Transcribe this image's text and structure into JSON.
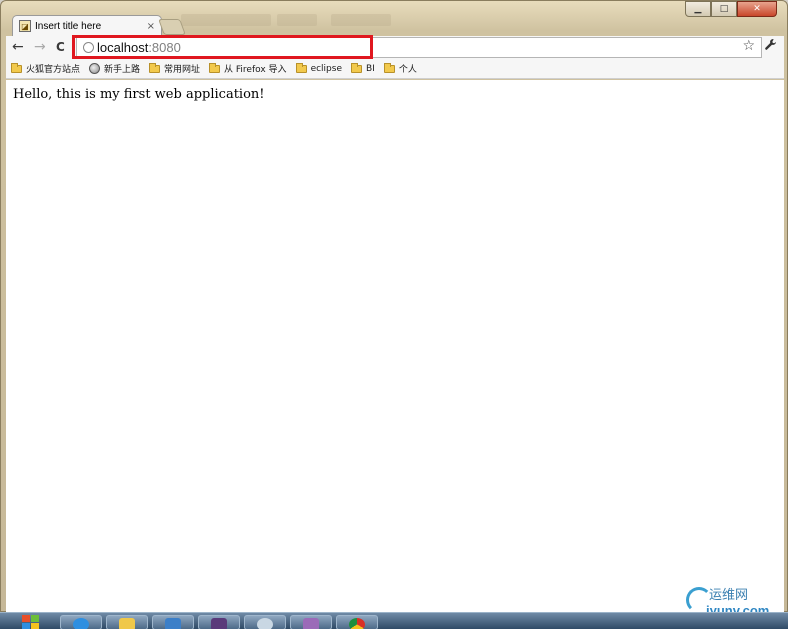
{
  "tab": {
    "title": "Insert title here",
    "close": "×"
  },
  "window_controls": {
    "minimize": "▁",
    "maximize": "□",
    "close": "✕"
  },
  "toolbar": {
    "back": "←",
    "forward": "→",
    "reload": "C",
    "url_host": "localhost",
    "url_port": ":8080",
    "star": "☆",
    "wrench": "🔧"
  },
  "bookmarks": [
    {
      "label": "火狐官方站点",
      "icon": "folder-icon"
    },
    {
      "label": "新手上路",
      "icon": "globe-icon"
    },
    {
      "label": "常用网址",
      "icon": "folder-icon"
    },
    {
      "label": "从 Firefox 导入",
      "icon": "folder-icon"
    },
    {
      "label": "eclipse",
      "icon": "folder-icon"
    },
    {
      "label": "BI",
      "icon": "folder-icon"
    },
    {
      "label": "个人",
      "icon": "folder-icon"
    }
  ],
  "page": {
    "text": "Hello, this is my first web application!"
  },
  "watermark": {
    "cn": "运维网",
    "en": "iyunv.com"
  },
  "colors": {
    "highlight_border": "#e0171f",
    "watermark": "#3a9fd0"
  }
}
